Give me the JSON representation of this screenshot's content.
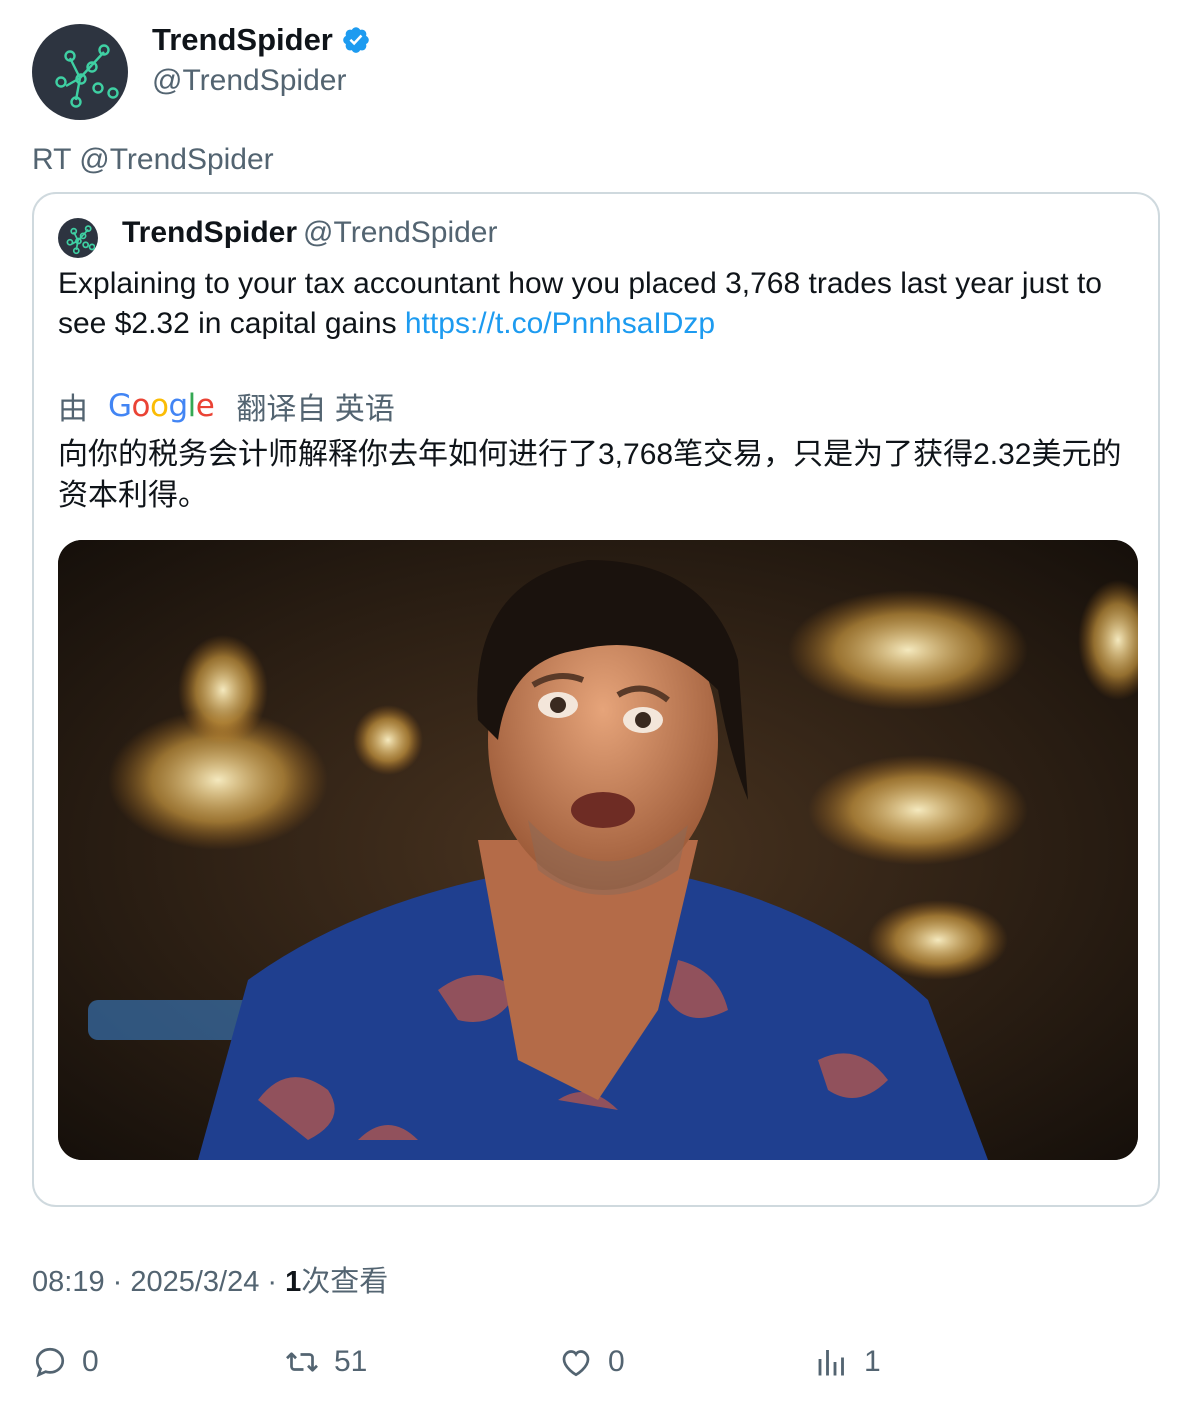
{
  "author": {
    "name": "TrendSpider",
    "handle": "@TrendSpider",
    "verified": true
  },
  "retweet_label": "RT @TrendSpider",
  "quoted": {
    "name": "TrendSpider",
    "handle": "@TrendSpider",
    "text": "Explaining to your tax accountant how you placed 3,768 trades last year just to see $2.32 in capital gains ",
    "link": "https://t.co/PnnhsaIDzp",
    "translation": {
      "prefix": "由",
      "provider": "Google",
      "label": "翻译自 英语",
      "text": "向你的税务会计师解释你去年如何进行了3,768笔交易，只是为了获得2.32美元的资本利得。"
    },
    "media_icon": "photo-man-surprised"
  },
  "meta": {
    "time_date": "08:19 · 2025/3/24 · ",
    "views_count": "1",
    "views_label": "次查看"
  },
  "actions": {
    "replies": "0",
    "retweets": "51",
    "likes": "0",
    "views": "1"
  },
  "colors": {
    "link": "#1d9bf0",
    "muted": "#536471",
    "avatar_bg": "#2d3440",
    "logo_green": "#3fd0a3"
  }
}
